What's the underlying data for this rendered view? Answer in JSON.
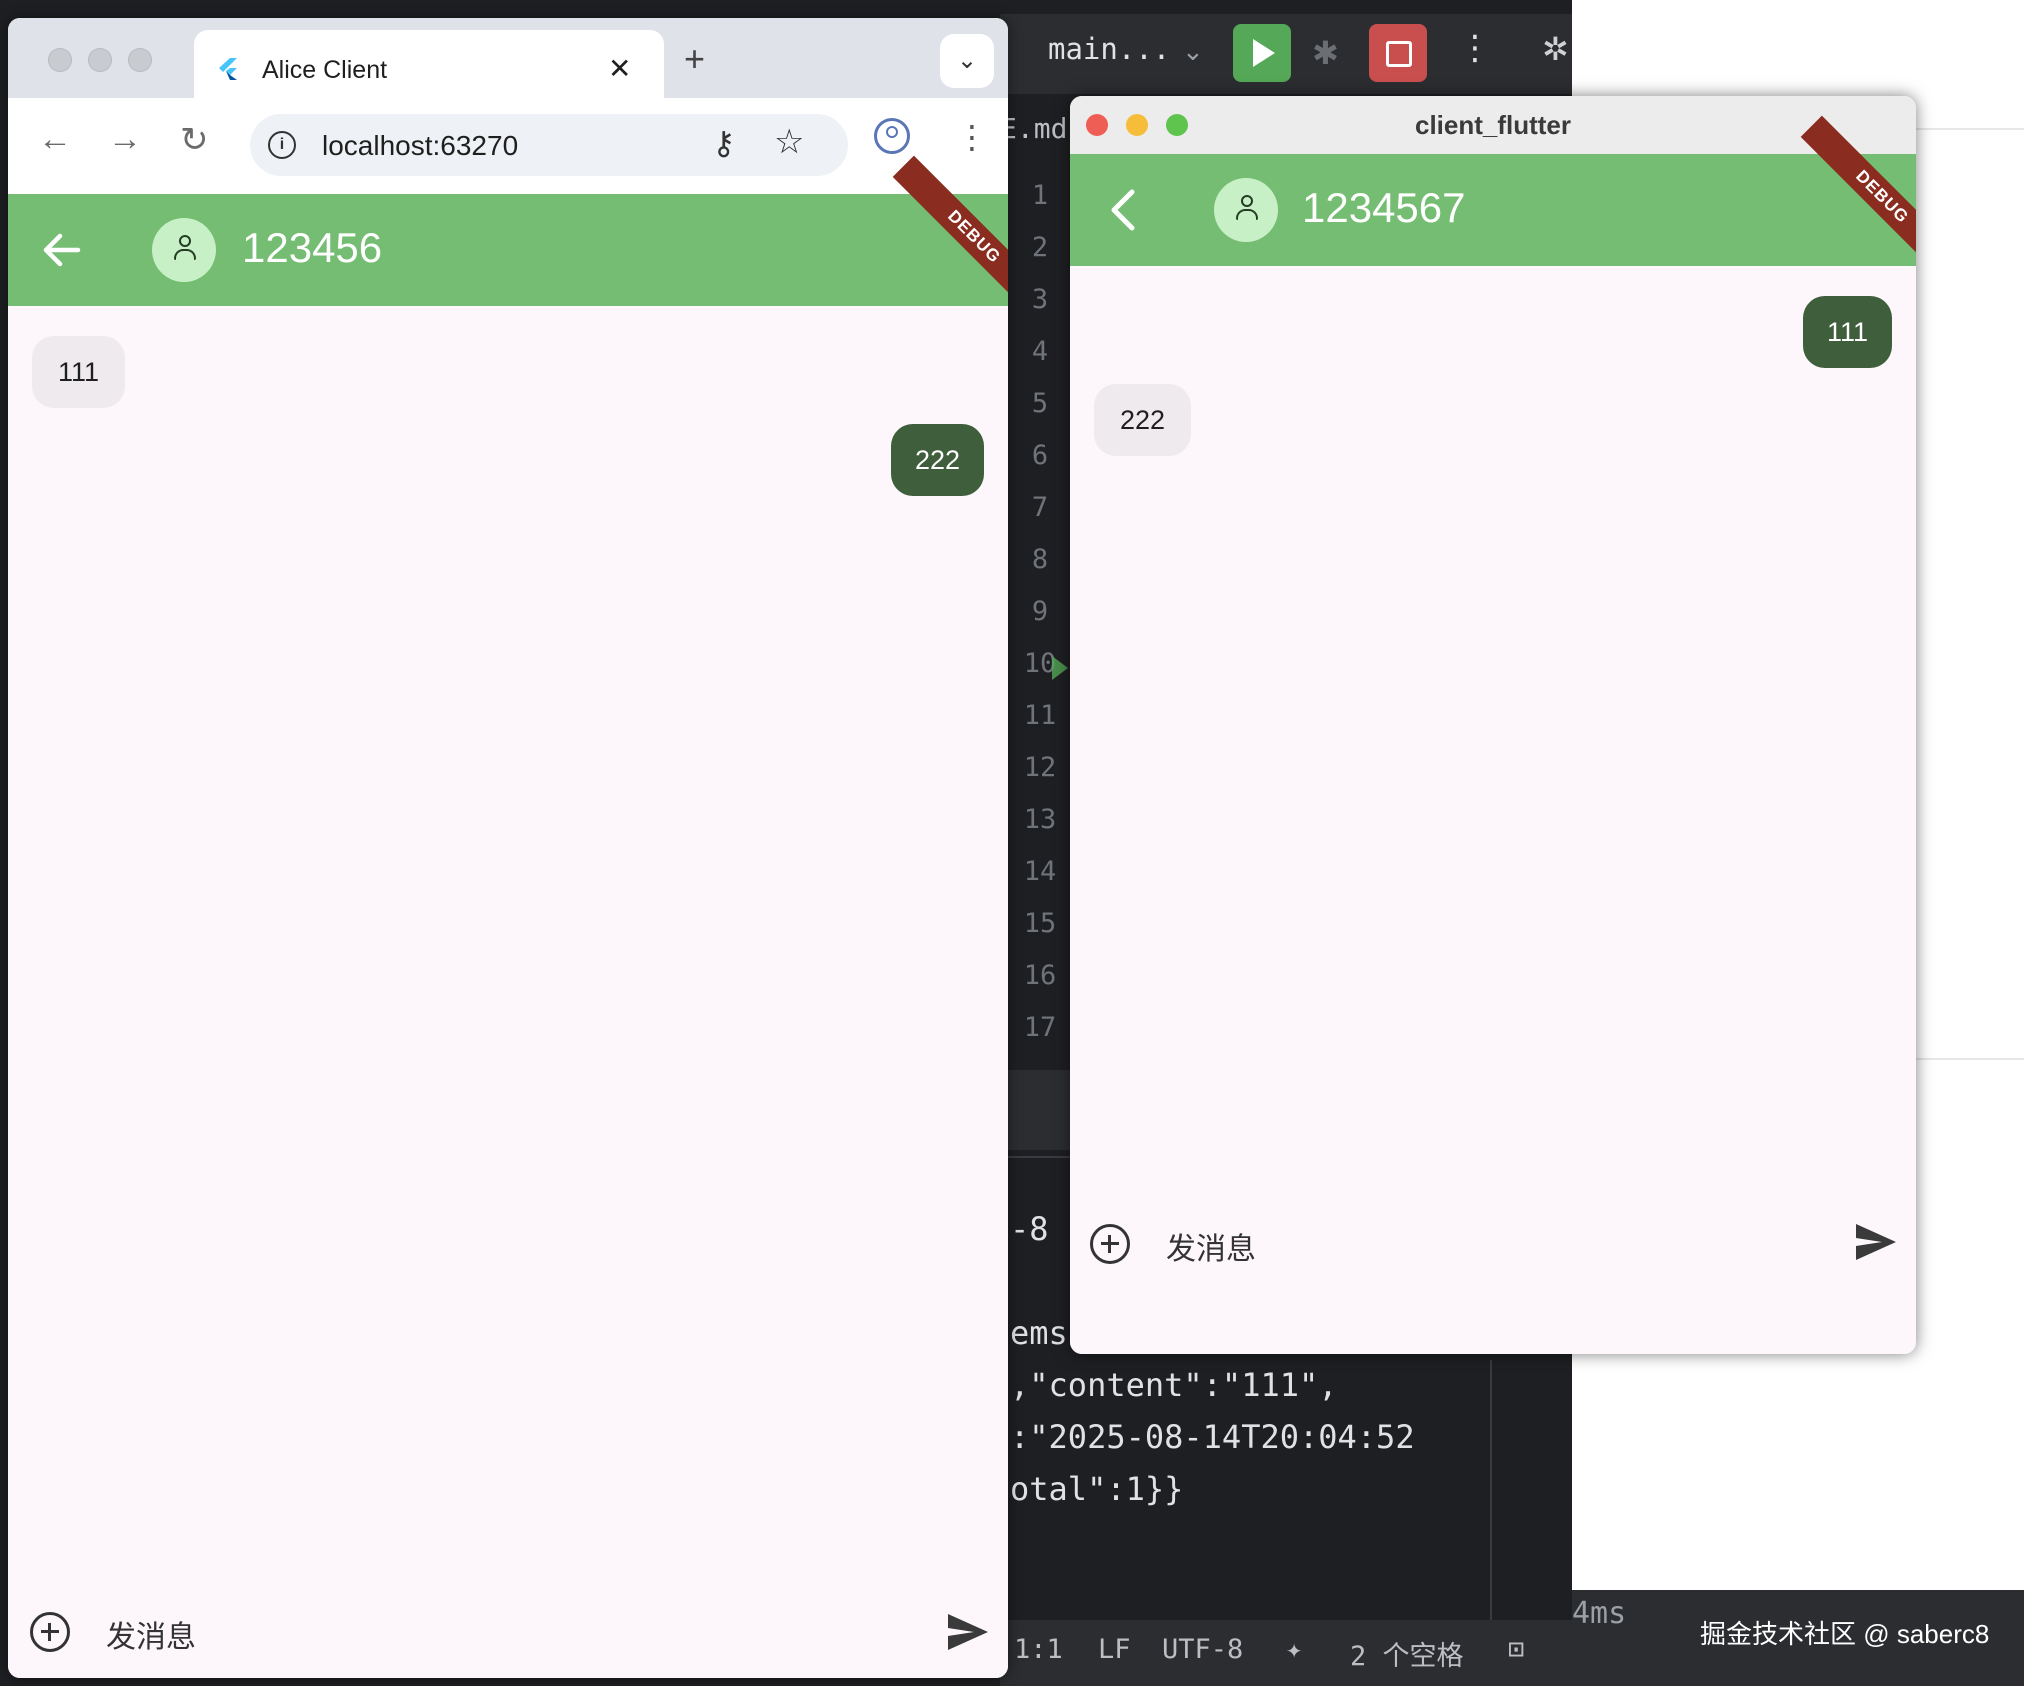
{
  "ide": {
    "branch": "main...",
    "file_tab": "E.md",
    "line_numbers": [
      "1",
      "2",
      "3",
      "4",
      "5",
      "6",
      "7",
      "8",
      "9",
      "10",
      "11",
      "12",
      "13",
      "14",
      "15",
      "16",
      "17"
    ],
    "console_lines": [
      "-8",
      "ems\"",
      ",\"content\":\"111\",",
      ":\"2025-08-14T20:04:52",
      "otal\":1}}"
    ],
    "status": {
      "position": "1:1",
      "line_sep": "LF",
      "encoding": "UTF-8",
      "indent": "2 个空格"
    },
    "timing": "4ms"
  },
  "watermark": "掘金技术社区 @ saberc8",
  "browser": {
    "tab_title": "Alice Client",
    "url": "localhost:63270",
    "app": {
      "title": "123456",
      "debug_banner": "DEBUG",
      "messages": [
        {
          "text": "111",
          "direction": "incoming"
        },
        {
          "text": "222",
          "direction": "outgoing"
        }
      ],
      "input_placeholder": "发消息"
    }
  },
  "native_window": {
    "title": "client_flutter",
    "app": {
      "title": "1234567",
      "debug_banner": "DEBUG",
      "messages": [
        {
          "text": "111",
          "direction": "outgoing"
        },
        {
          "text": "222",
          "direction": "incoming"
        }
      ],
      "input_placeholder": "发消息"
    }
  },
  "colors": {
    "appbar": "#74bd72",
    "outgoing_bubble": "#3f5e3c",
    "incoming_bubble": "#eeeaee",
    "debug_banner": "#8a2d20",
    "ide_background": "#1e1f22"
  },
  "icons": [
    "back-arrow-icon",
    "forward-arrow-icon",
    "reload-icon",
    "info-icon",
    "key-icon",
    "star-icon",
    "profile-icon",
    "more-vert-icon",
    "person-icon",
    "add-circle-icon",
    "send-icon",
    "run-icon",
    "debug-icon",
    "stop-icon",
    "flutter-logo-icon"
  ]
}
